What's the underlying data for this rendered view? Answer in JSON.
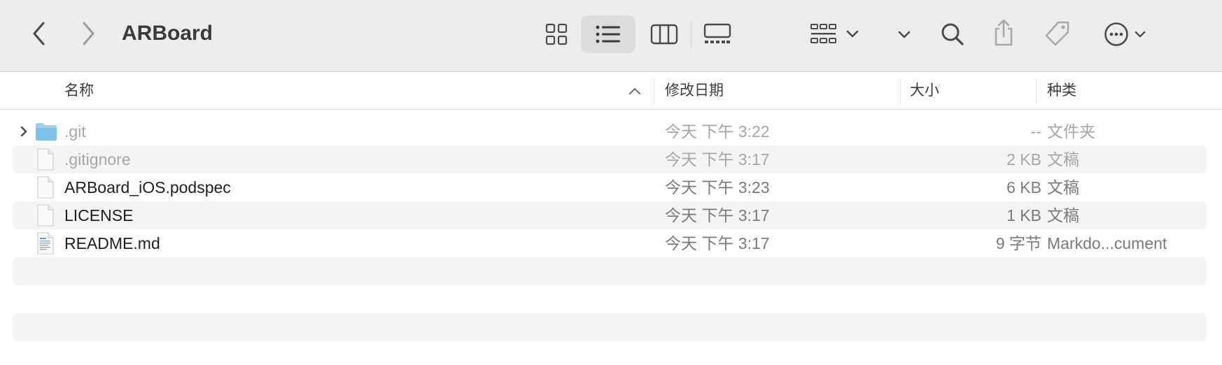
{
  "window": {
    "title": "ARBoard"
  },
  "toolbar": {
    "back_icon": "chevron-left-icon",
    "forward_icon": "chevron-right-icon",
    "views": [
      "icon-view-icon",
      "list-view-icon",
      "column-view-icon",
      "gallery-view-icon"
    ],
    "active_view": "list-view-icon",
    "group_icon": "group-by-icon",
    "search_icon": "search-icon",
    "share_icon": "share-icon",
    "tag_icon": "tag-icon",
    "more_icon": "more-icon"
  },
  "columns": {
    "name": "名称",
    "modified": "修改日期",
    "size": "大小",
    "kind": "种类"
  },
  "files": [
    {
      "name": ".git",
      "modified": "今天 下午 3:22",
      "size": "--",
      "kind": "文件夹",
      "icon": "folder-icon",
      "hidden": true,
      "expandable": true
    },
    {
      "name": ".gitignore",
      "modified": "今天 下午 3:17",
      "size": "2 KB",
      "kind": "文稿",
      "icon": "document-icon",
      "hidden": true,
      "expandable": false
    },
    {
      "name": "ARBoard_iOS.podspec",
      "modified": "今天 下午 3:23",
      "size": "6 KB",
      "kind": "文稿",
      "icon": "document-icon",
      "hidden": false,
      "expandable": false
    },
    {
      "name": "LICENSE",
      "modified": "今天 下午 3:17",
      "size": "1 KB",
      "kind": "文稿",
      "icon": "document-icon",
      "hidden": false,
      "expandable": false
    },
    {
      "name": "README.md",
      "modified": "今天 下午 3:17",
      "size": "9 字节",
      "kind": "Markdo...cument",
      "icon": "markdown-document-icon",
      "hidden": false,
      "expandable": false
    }
  ],
  "colors": {
    "toolbar_bg": "#ececec",
    "alt_row": "#f3f4f4",
    "folder": "#8cc8ee"
  }
}
